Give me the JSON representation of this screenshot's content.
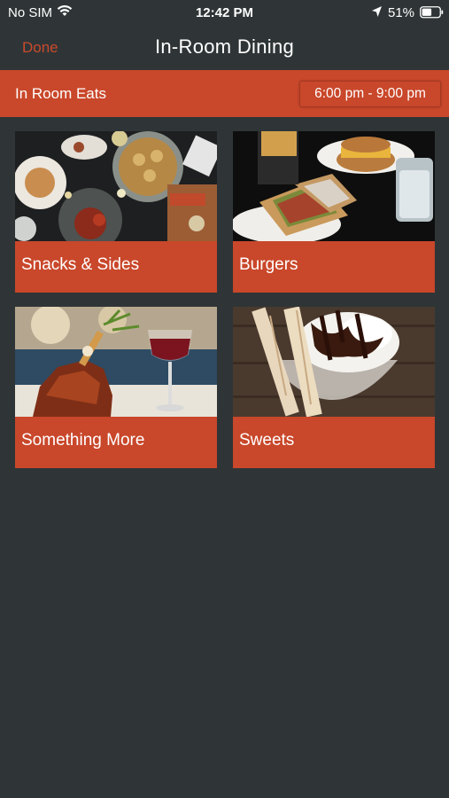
{
  "status_bar": {
    "carrier": "No SIM",
    "time": "12:42 PM",
    "battery": "51%"
  },
  "nav": {
    "done_label": "Done",
    "title": "In-Room Dining"
  },
  "section": {
    "label": "In Room Eats",
    "hours": "6:00 pm - 9:00 pm"
  },
  "categories": [
    {
      "label": "Snacks & Sides",
      "image": "snacks-sides-photo"
    },
    {
      "label": "Burgers",
      "image": "burgers-photo"
    },
    {
      "label": "Something More",
      "image": "something-more-photo"
    },
    {
      "label": "Sweets",
      "image": "sweets-photo"
    }
  ],
  "colors": {
    "background": "#2f3537",
    "accent": "#c9472a",
    "text": "#ffffff"
  }
}
